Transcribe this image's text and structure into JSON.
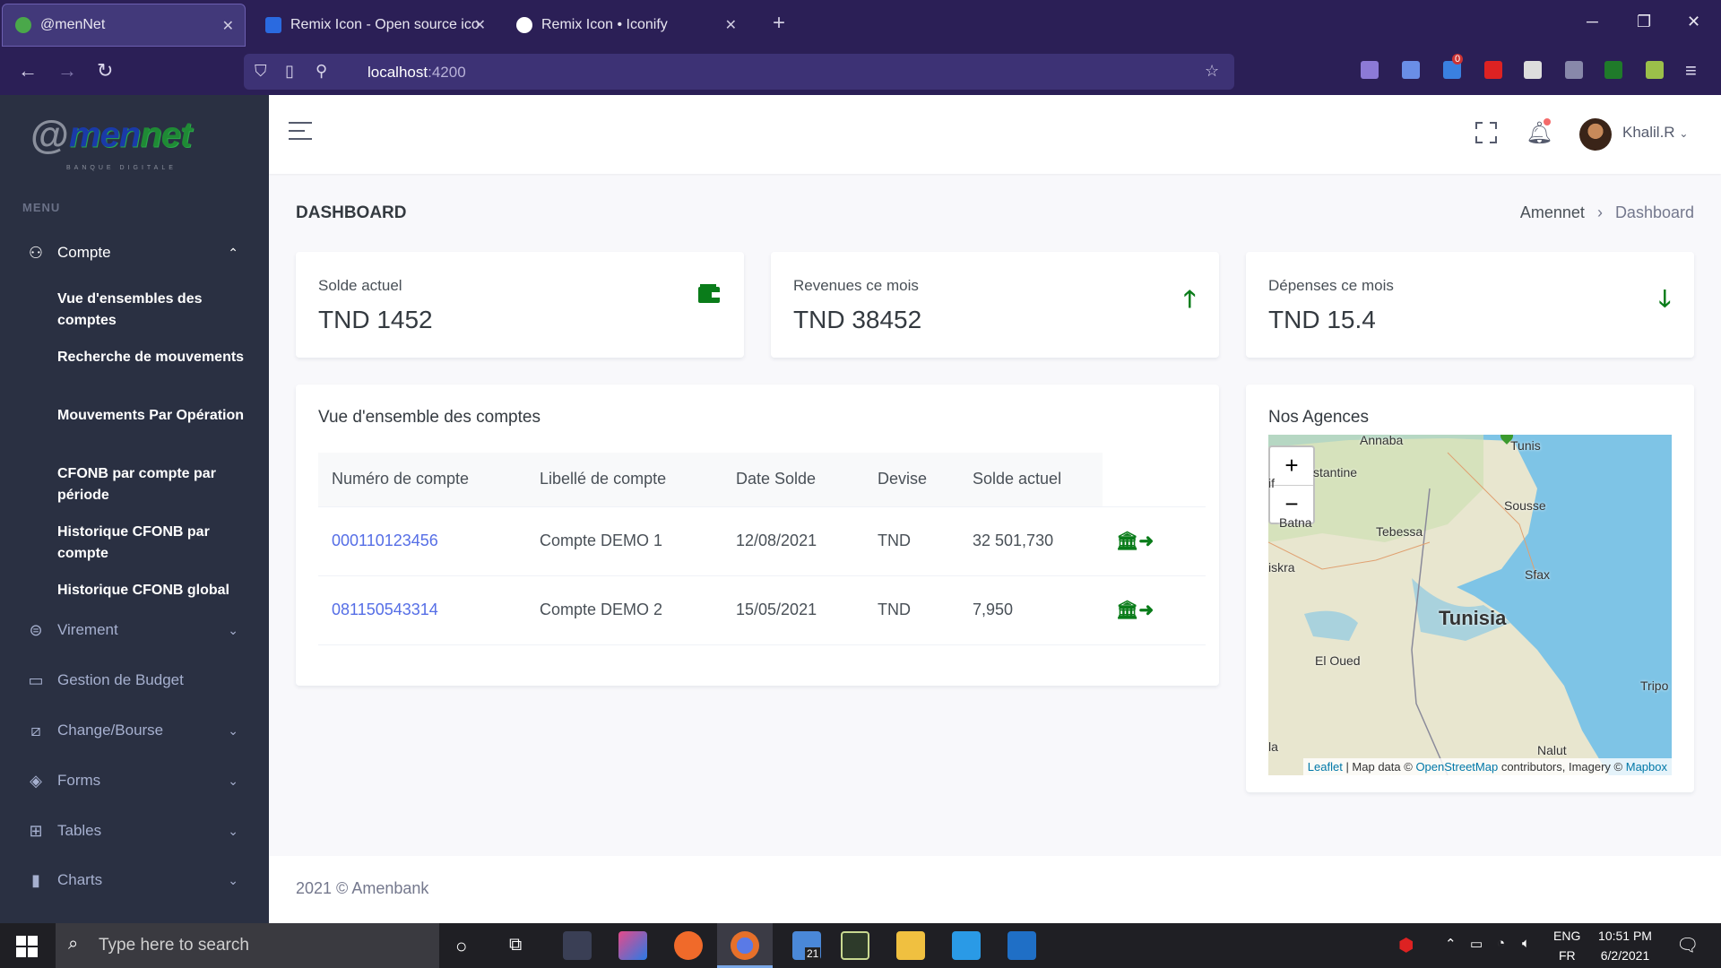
{
  "browser": {
    "tabs": [
      {
        "title": "@menNet",
        "active": true
      },
      {
        "title": "Remix Icon - Open source icon",
        "active": false
      },
      {
        "title": "Remix Icon • Iconify",
        "active": false
      }
    ],
    "url_host": "localhost",
    "url_port": ":4200",
    "badge_count": "0"
  },
  "sidebar": {
    "logo_at": "@",
    "logo_brand_1": "men",
    "logo_brand_2": "net",
    "logo_sub": "BANQUE DIGITALE",
    "menu_title": "MENU",
    "items": [
      {
        "label": "Compte",
        "icon": "user-icon",
        "open": true
      },
      {
        "label": "Virement",
        "icon": "exchange-icon"
      },
      {
        "label": "Gestion de Budget",
        "icon": "wallet-icon"
      },
      {
        "label": "Change/Bourse",
        "icon": "chart-line-icon"
      },
      {
        "label": "Forms",
        "icon": "eraser-icon"
      },
      {
        "label": "Tables",
        "icon": "table-icon"
      },
      {
        "label": "Charts",
        "icon": "bar-chart-icon"
      }
    ],
    "subitems": [
      "Vue d'ensembles des comptes",
      "Recherche de mouvements",
      "Mouvements Par Opération",
      "CFONB par compte par période",
      "Historique CFONB par compte",
      "Historique CFONB global"
    ]
  },
  "topbar": {
    "username": "Khalil.R"
  },
  "page": {
    "title": "DASHBOARD",
    "breadcrumb": [
      "Amennet",
      "Dashboard"
    ]
  },
  "stats": [
    {
      "label": "Solde actuel",
      "value": "TND 1452",
      "icon": "wallet-icon"
    },
    {
      "label": "Revenues ce mois",
      "value": "TND 38452",
      "icon": "arrow-up-icon"
    },
    {
      "label": "Dépenses ce mois",
      "value": "TND 15.4",
      "icon": "arrow-down-icon"
    }
  ],
  "accounts": {
    "title": "Vue d'ensemble des comptes",
    "headers": [
      "Numéro de compte",
      "Libellé de compte",
      "Date Solde",
      "Devise",
      "Solde actuel"
    ],
    "rows": [
      {
        "numero": "000110123456",
        "libelle": "Compte DEMO 1",
        "date": "12/08/2021",
        "devise": "TND",
        "solde": "32 501,730"
      },
      {
        "numero": "081150543314",
        "libelle": "Compte DEMO 2",
        "date": "15/05/2021",
        "devise": "TND",
        "solde": "7,950"
      }
    ]
  },
  "map": {
    "title": "Nos Agences",
    "zoom_in": "+",
    "zoom_out": "−",
    "labels": [
      "Annaba",
      "Tunis",
      "stantine",
      "if",
      "Sousse",
      "Batna",
      "Tebessa",
      "iskra",
      "Sfax",
      "Tunisia",
      "El Oued",
      "Tripo",
      "la",
      "Nalut"
    ],
    "attribution": {
      "leaflet": "Leaflet",
      "text1": " | Map data © ",
      "osm": "OpenStreetMap",
      "text2": " contributors, Imagery © ",
      "mapbox": "Mapbox"
    }
  },
  "footer": {
    "text": "2021 © Amenbank"
  },
  "taskbar": {
    "search_placeholder": "Type here to search",
    "lang": "ENG",
    "region": "FR",
    "time": "10:51 PM",
    "date": "6/2/2021",
    "badge": "21"
  },
  "colors": {
    "sidebar_bg": "#2a3042",
    "accent_link": "#556ee6",
    "icon_green": "#0a7c1a",
    "browser_chrome": "#2b1f56"
  }
}
